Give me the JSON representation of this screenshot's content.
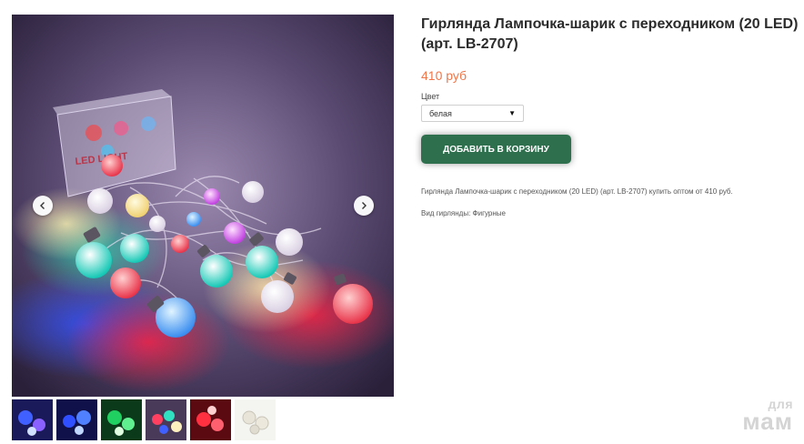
{
  "product": {
    "title": "Гирлянда Лампочка-шарик с переходником (20 LED) (арт. LB-2707)",
    "price": "410 руб",
    "option_label": "Цвет",
    "option_selected": "белая",
    "add_to_cart_label": "ДОБАВИТЬ В КОРЗИНУ",
    "description": "Гирлянда Лампочка-шарик с переходником (20 LED) (арт. LB-2707) купить оптом от 410 руб.",
    "property": "Вид гирлянды: Фигурные"
  },
  "gallery": {
    "box_label": "LED LIGHT",
    "thumbnails": [
      {
        "tone": "blue-violet"
      },
      {
        "tone": "blue"
      },
      {
        "tone": "green"
      },
      {
        "tone": "multicolor"
      },
      {
        "tone": "red"
      },
      {
        "tone": "white"
      }
    ]
  },
  "watermark": {
    "top": "для",
    "bottom": "мам"
  },
  "colors": {
    "price": "#f0774a",
    "button": "#2e6f4e"
  }
}
